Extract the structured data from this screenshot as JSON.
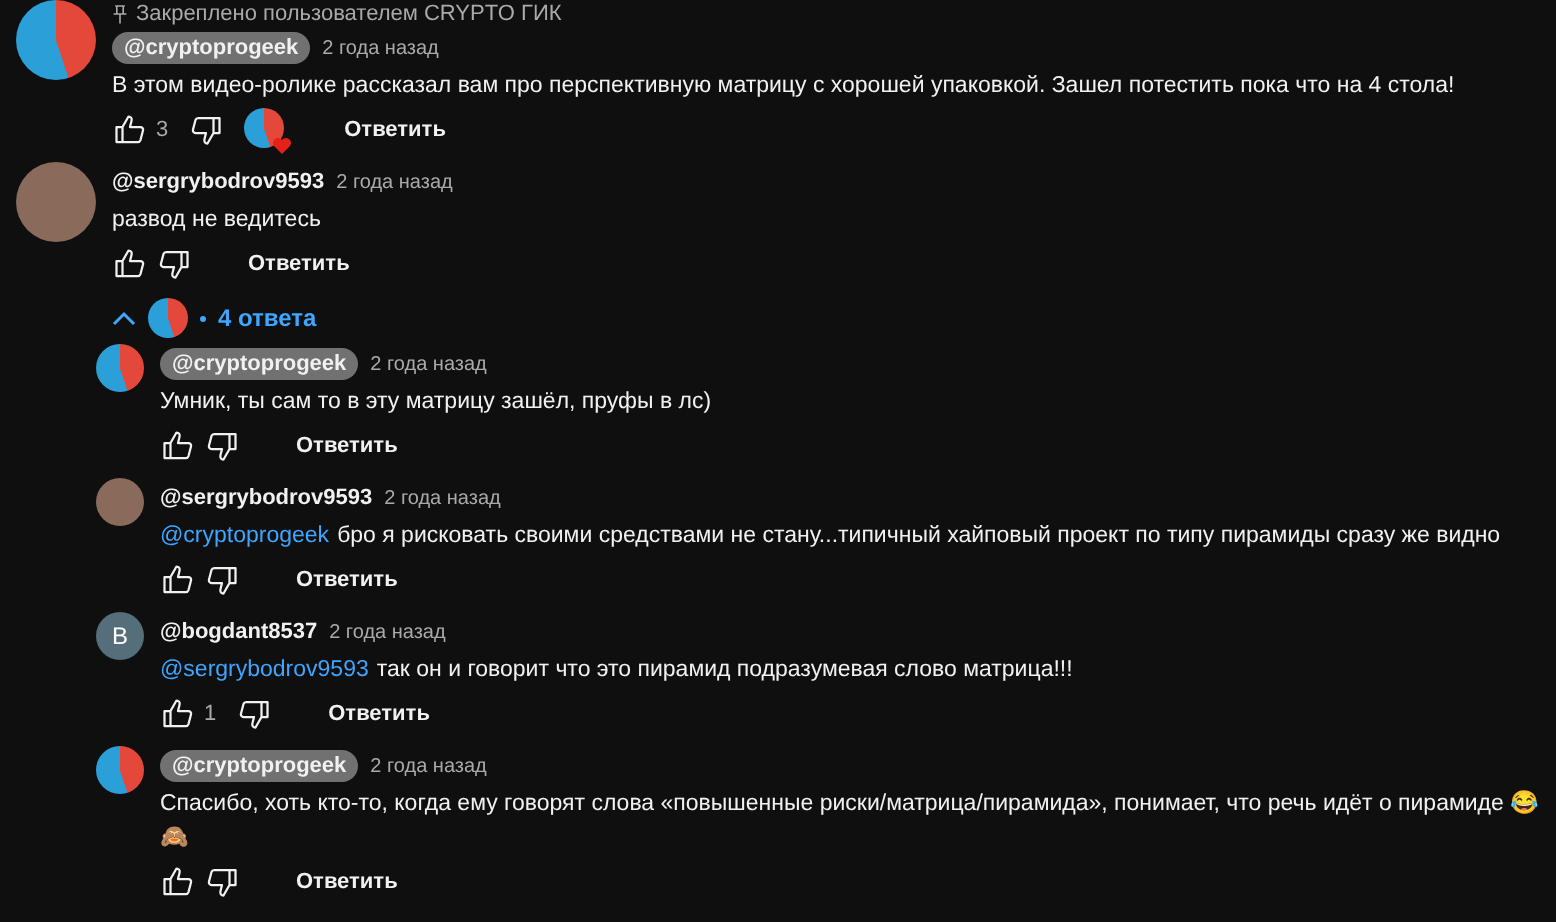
{
  "comments": [
    {
      "pinned_label": "Закреплено пользователем CRYPTO ГИК",
      "avatar": {
        "kind": "logo"
      },
      "author": "@cryptoprogeek",
      "is_owner": true,
      "time": "2 года назад",
      "text": "В этом видео-ролике рассказал вам про перспективную матрицу с хорошей упаковкой. Зашел потестить пока что на 4 стола!",
      "likes": "3",
      "creator_heart": true,
      "reply_button": "Ответить"
    },
    {
      "avatar": {
        "kind": "photo"
      },
      "author": "@sergrybodrov9593",
      "is_owner": false,
      "time": "2 года назад",
      "text": "развод не ведитесь",
      "creator_heart": false,
      "reply_button": "Ответить",
      "replies_toggle": {
        "label": "4 ответа",
        "expanded": true
      },
      "replies": [
        {
          "avatar": {
            "kind": "logo"
          },
          "author": "@cryptoprogeek",
          "is_owner": true,
          "time": "2 года назад",
          "text": "Умник, ты сам то в эту матрицу зашёл, пруфы в лс)",
          "creator_heart": false,
          "reply_button": "Ответить"
        },
        {
          "avatar": {
            "kind": "photo"
          },
          "author": "@sergrybodrov9593",
          "is_owner": false,
          "time": "2 года назад",
          "mention": "@cryptoprogeek",
          "text": "бро я рисковать своими средствами не стану...типичный хайповый проект по типу пирамиды  сразу же видно",
          "creator_heart": false,
          "reply_button": "Ответить"
        },
        {
          "avatar": {
            "kind": "letter",
            "letter": "B"
          },
          "author": "@bogdant8537",
          "is_owner": false,
          "time": "2 года назад",
          "mention": "@sergrybodrov9593",
          "text": "так он и говорит что это пирамид подразумевая слово матрица!!!",
          "likes": "1",
          "creator_heart": false,
          "reply_button": "Ответить"
        },
        {
          "avatar": {
            "kind": "logo"
          },
          "author": "@cryptoprogeek",
          "is_owner": true,
          "time": "2 года назад",
          "text": "Спасибо, хоть кто-то, когда ему говорят слова «повышенные риски/матрица/пирамида», понимает, что речь идёт о пирамиде 😂 🙈",
          "creator_heart": false,
          "reply_button": "Ответить"
        }
      ]
    }
  ]
}
